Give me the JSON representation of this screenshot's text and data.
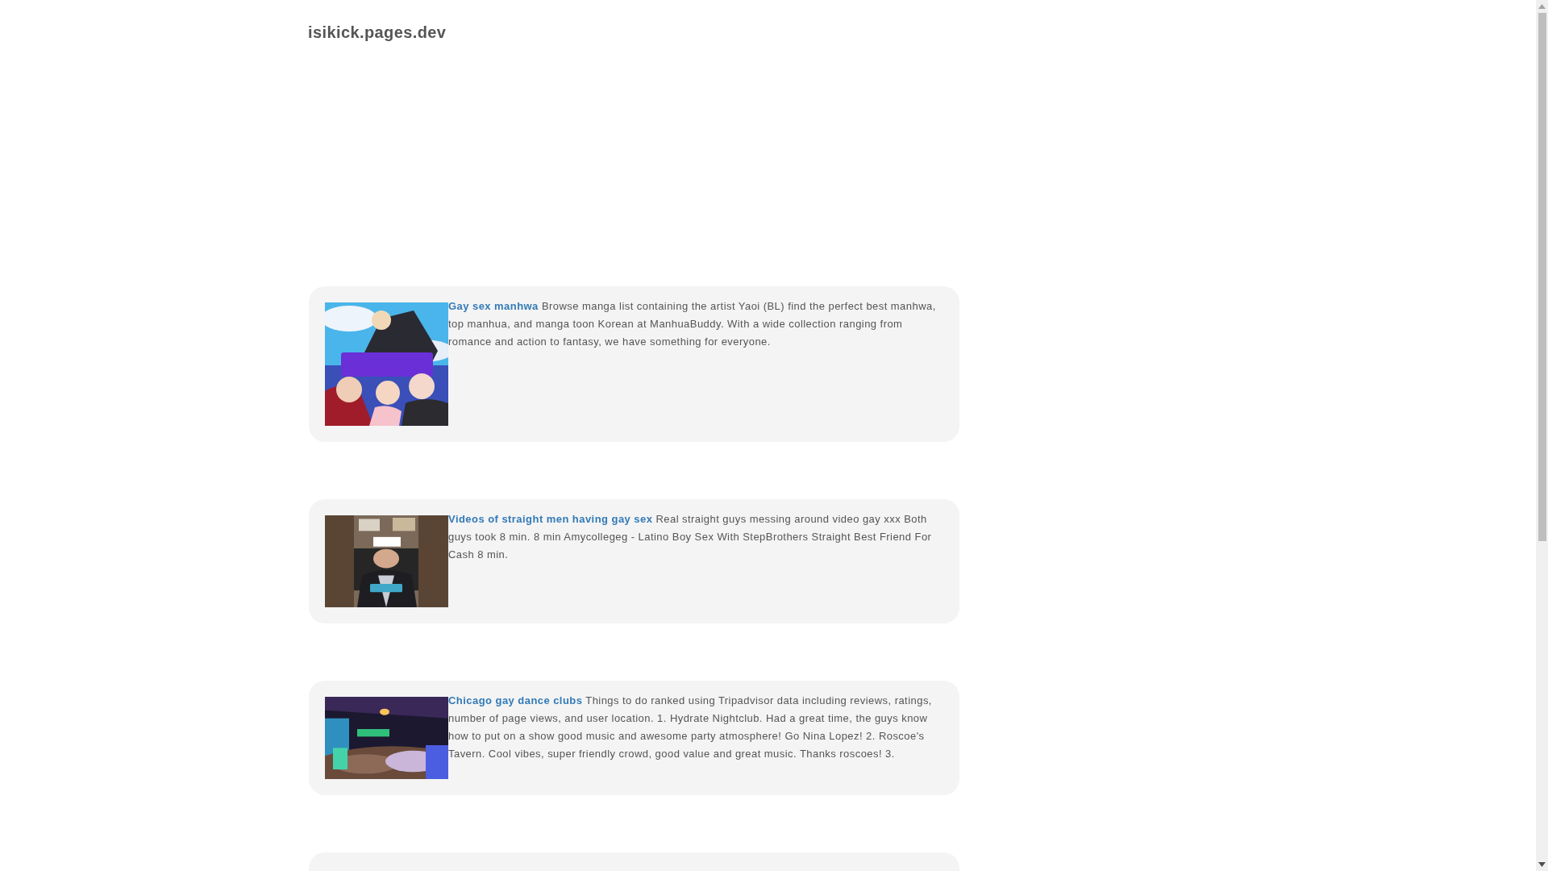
{
  "site_title": "isikick.pages.dev",
  "results": [
    {
      "title": "Gay sex manhwa",
      "description": "Browse manga list containing the artist Yaoi (BL) find the perfect best manhwa, top manhua, and manga toon Korean at ManhuaBuddy. With a wide collection ranging from romance and action to fantasy, we have something for everyone."
    },
    {
      "title": "Videos of straight men having gay sex",
      "description": "Real straight guys messing around video gay xxx Both guys took 8 min. 8 min Amycollegeg - Latino Boy Sex With StepBrothers Straight Best Friend For Cash 8 min."
    },
    {
      "title": "Chicago gay dance clubs",
      "description": "Things to do ranked using Tripadvisor data including reviews, ratings, number of page views, and user location. 1. Hydrate Nightclub. Had a great time, the guys know how to put on a show good music and awesome party atmosphere! Go Nina Lopez! 2. Roscoe's Tavern. Cool vibes, super friendly crowd, good value and great music. Thanks roscoes! 3."
    }
  ]
}
